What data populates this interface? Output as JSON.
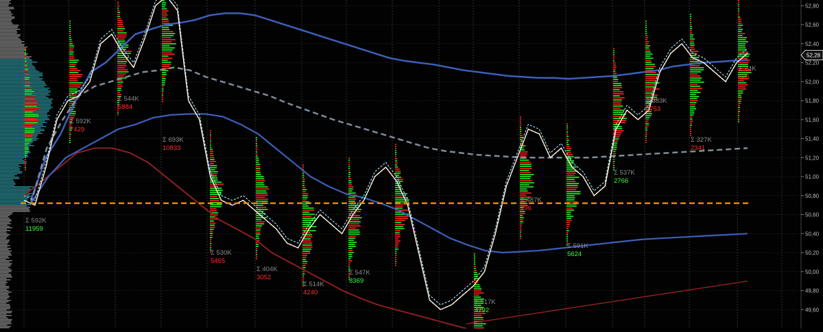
{
  "chart_data": {
    "type": "line",
    "title": "",
    "xlabel": "",
    "ylabel": "",
    "ylim": [
      49.4,
      52.86
    ],
    "y_tick_labels": [
      "52,80",
      "52,60",
      "52,40",
      "52,20",
      "52,00",
      "51,80",
      "51,60",
      "51,40",
      "51,20",
      "51,00",
      "50,80",
      "50,60",
      "50,40",
      "50,20",
      "50,00",
      "49,80",
      "49,60"
    ],
    "y_tick_values": [
      52.8,
      52.6,
      52.4,
      52.2,
      52.0,
      51.8,
      51.6,
      51.4,
      51.2,
      51.0,
      50.8,
      50.6,
      50.4,
      50.2,
      50.0,
      49.8,
      49.6
    ],
    "last_price_label": "52,28",
    "last_price": 52.28,
    "poc_level": 50.72,
    "grid": true,
    "background": "#020202",
    "colors": {
      "price": "#f2f2f2",
      "vwap": "#ffa020",
      "ma_fast": "#9ed6f0",
      "ma_blue": "#3d5fb8",
      "ma_dashed": "#7f8c99",
      "band_red": "#8b2020",
      "band_blue": "#3048b0",
      "poc": "#e58a00",
      "vol_buy": "#1ec81e",
      "vol_sell": "#d81c1c",
      "annotation_gray": "#8a8a8a",
      "annotation_red": "#ff3030",
      "annotation_green": "#3cff3c",
      "profile_teal": "#2a8f99",
      "profile_gray": "#8a8a8a"
    },
    "sessions": [
      {
        "id": "s1",
        "x": 35,
        "sum_label": "Σ 592K",
        "delta_label": "11959",
        "delta_color": "green"
      },
      {
        "id": "s2",
        "x": 100,
        "sum_label": "Σ 592K",
        "delta_label": "7429",
        "delta_color": "red"
      },
      {
        "id": "s3",
        "x": 170,
        "sum_label": "Σ 544K",
        "delta_label": "5884",
        "delta_color": "red"
      },
      {
        "id": "s4",
        "x": 235,
        "sum_label": "Σ 693K",
        "delta_label": "10833",
        "delta_color": "red"
      },
      {
        "id": "s5",
        "x": 305,
        "sum_label": "Σ 530K",
        "delta_label": "5465",
        "delta_color": "red"
      },
      {
        "id": "s6",
        "x": 372,
        "sum_label": "Σ 404K",
        "delta_label": "3052",
        "delta_color": "red"
      },
      {
        "id": "s7",
        "x": 440,
        "sum_label": "Σ 514K",
        "delta_label": "4240",
        "delta_color": "red"
      },
      {
        "id": "s8",
        "x": 507,
        "sum_label": "Σ 547K",
        "delta_label": "8369",
        "delta_color": "green"
      },
      {
        "id": "s9",
        "x": 575,
        "sum_label": "",
        "delta_label": "",
        "delta_color": "red"
      },
      {
        "id": "s10",
        "x": 690,
        "sum_label": "Σ 517K",
        "delta_label": "4792",
        "delta_color": "green"
      },
      {
        "id": "s11",
        "x": 757,
        "sum_label": "Σ 487K",
        "delta_label": "296",
        "delta_color": "red"
      },
      {
        "id": "s12",
        "x": 825,
        "sum_label": "Σ 591K",
        "delta_label": "5624",
        "delta_color": "green"
      },
      {
        "id": "s13",
        "x": 893,
        "sum_label": "Σ 537K",
        "delta_label": "2766",
        "delta_color": "green"
      },
      {
        "id": "s14",
        "x": 940,
        "sum_label": "Σ 383K",
        "delta_label": "2753",
        "delta_color": "red"
      },
      {
        "id": "s15",
        "x": 1005,
        "sum_label": "Σ 327K",
        "delta_label": "2341",
        "delta_color": "red"
      },
      {
        "id": "s16",
        "x": 1075,
        "sum_label": "Σ 34K",
        "delta_label": "625",
        "delta_color": "red"
      }
    ],
    "series": [
      {
        "key": "price",
        "values": [
          50.75,
          50.7,
          51.1,
          51.6,
          51.8,
          51.85,
          52.0,
          52.4,
          52.5,
          52.3,
          52.15,
          52.45,
          52.8,
          52.9,
          52.75,
          51.8,
          51.6,
          51.0,
          50.75,
          50.7,
          50.75,
          50.65,
          50.55,
          50.45,
          50.3,
          50.25,
          50.45,
          50.6,
          50.5,
          50.4,
          50.6,
          50.75,
          51.0,
          51.1,
          50.95,
          50.7,
          50.2,
          49.7,
          49.6,
          49.65,
          49.75,
          49.85,
          50.0,
          50.4,
          50.9,
          51.2,
          51.5,
          51.45,
          51.2,
          51.3,
          51.1,
          51.0,
          50.8,
          50.9,
          51.5,
          51.7,
          51.6,
          51.7,
          52.1,
          52.3,
          52.4,
          52.25,
          52.2,
          52.1,
          52.0,
          52.2,
          52.3
        ]
      },
      {
        "key": "ma_blue_long",
        "values": [
          50.75,
          51.2,
          51.45,
          51.8,
          52.1,
          52.2,
          52.35,
          52.5,
          52.55,
          52.6,
          52.62,
          52.65,
          52.7,
          52.72,
          52.72,
          52.7,
          52.65,
          52.6,
          52.55,
          52.5,
          52.45,
          52.4,
          52.35,
          52.3,
          52.25,
          52.22,
          52.2,
          52.18,
          52.15,
          52.12,
          52.1,
          52.08,
          52.06,
          52.05,
          52.04,
          52.04,
          52.03,
          52.04,
          52.05,
          52.06,
          52.08,
          52.1,
          52.12,
          52.16,
          52.18,
          52.2,
          52.21,
          52.22,
          52.23
        ]
      },
      {
        "key": "ma_dashed",
        "values": [
          50.72,
          51.3,
          51.6,
          51.85,
          51.95,
          52.0,
          52.05,
          52.1,
          52.12,
          52.15,
          52.12,
          52.05,
          52.0,
          51.95,
          51.9,
          51.85,
          51.78,
          51.72,
          51.66,
          51.6,
          51.55,
          51.5,
          51.45,
          51.4,
          51.35,
          51.3,
          51.27,
          51.25,
          51.23,
          51.22,
          51.21,
          51.2,
          51.2,
          51.2,
          51.2,
          51.2,
          51.21,
          51.22,
          51.23,
          51.24,
          51.25,
          51.26,
          51.27,
          51.28,
          51.29,
          51.3
        ]
      },
      {
        "key": "ma_blue_slow",
        "values": [
          50.72,
          51.0,
          51.2,
          51.3,
          51.4,
          51.5,
          51.55,
          51.62,
          51.65,
          51.66,
          51.66,
          51.63,
          51.55,
          51.45,
          51.3,
          51.15,
          51.0,
          50.9,
          50.82,
          50.78,
          50.72,
          50.65,
          50.55,
          50.45,
          50.35,
          50.28,
          50.22,
          50.2,
          50.21,
          50.22,
          50.24,
          50.26,
          50.28,
          50.3,
          50.32,
          50.34,
          50.35,
          50.36,
          50.37,
          50.38,
          50.39,
          50.4
        ]
      },
      {
        "key": "band_red_low",
        "values": [
          50.8,
          50.95,
          51.1,
          51.25,
          51.3,
          51.3,
          51.25,
          51.15,
          51.0,
          50.85,
          50.7,
          50.55,
          50.45,
          50.35,
          50.2,
          50.1,
          50.0,
          49.9,
          49.8,
          49.72,
          49.65,
          49.6,
          49.55,
          49.5,
          49.45,
          49.4
        ]
      },
      {
        "key": "band_red_up",
        "values": [
          49.45,
          49.5,
          49.55,
          49.6,
          49.65,
          49.7,
          49.75,
          49.8,
          49.85,
          49.9
        ]
      }
    ]
  },
  "status": {
    "note": ""
  }
}
